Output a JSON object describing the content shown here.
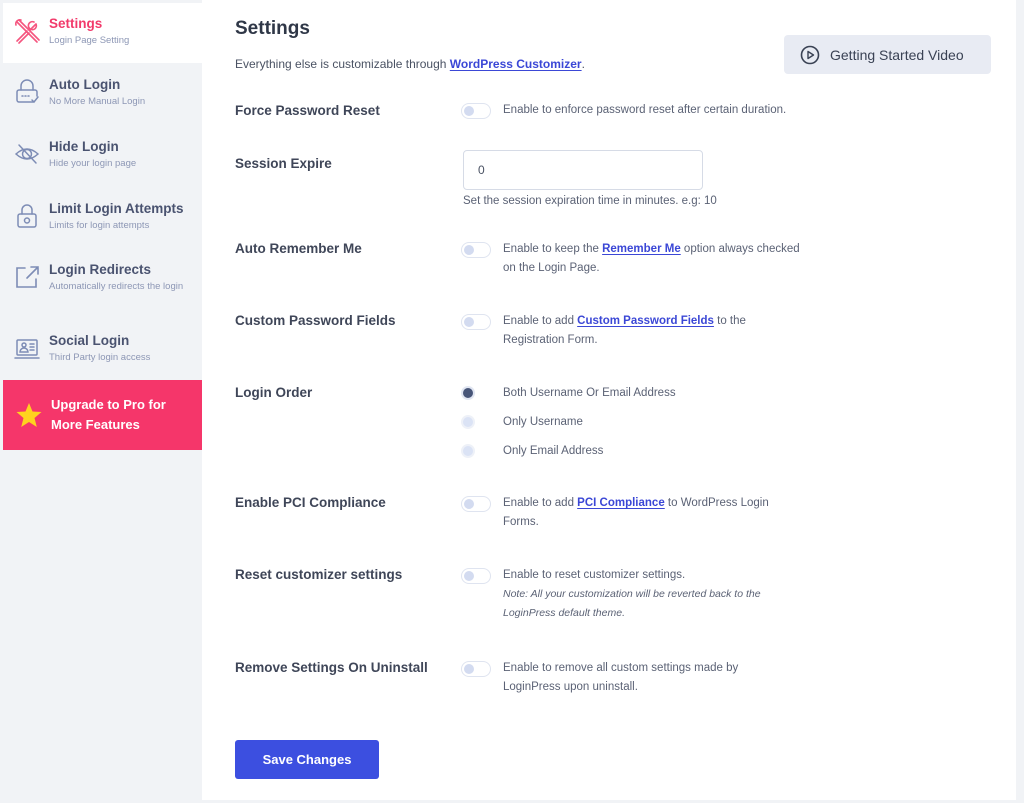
{
  "sidebar": {
    "items": [
      {
        "title": "Settings",
        "subtitle": "Login Page Setting",
        "icon": "tools-icon",
        "active": true
      },
      {
        "title": "Auto Login",
        "subtitle": "No More Manual Login",
        "icon": "lock-check-icon"
      },
      {
        "title": "Hide Login",
        "subtitle": "Hide your login page",
        "icon": "eye-slash-icon"
      },
      {
        "title": "Limit Login Attempts",
        "subtitle": "Limits for login attempts",
        "icon": "padlock-icon"
      },
      {
        "title": "Login Redirects",
        "subtitle": "Automatically redirects the login",
        "icon": "external-link-icon"
      },
      {
        "title": "Social Login",
        "subtitle": "Third Party login access",
        "icon": "id-card-icon"
      }
    ],
    "upgrade": {
      "label": "Upgrade to Pro for More Features",
      "icon": "star-icon"
    }
  },
  "header": {
    "title": "Settings",
    "intro_prefix": "Everything else is customizable through ",
    "intro_link": "WordPress Customizer",
    "intro_suffix": ".",
    "video_button": "Getting Started Video"
  },
  "settings": {
    "force_password_reset": {
      "label": "Force Password Reset",
      "enabled": false,
      "description": "Enable to enforce password reset after certain duration."
    },
    "session_expire": {
      "label": "Session Expire",
      "value": "0",
      "help": "Set the session expiration time in minutes. e.g: 10"
    },
    "auto_remember_me": {
      "label": "Auto Remember Me",
      "enabled": false,
      "desc_prefix": "Enable to keep the ",
      "desc_link": "Remember Me",
      "desc_suffix": " option always checked on the Login Page."
    },
    "custom_password_fields": {
      "label": "Custom Password Fields",
      "enabled": false,
      "desc_prefix": "Enable to add ",
      "desc_link": "Custom Password Fields",
      "desc_suffix": " to the Registration Form."
    },
    "login_order": {
      "label": "Login Order",
      "options": [
        "Both Username Or Email Address",
        "Only Username",
        "Only Email Address"
      ],
      "selected": "Both Username Or Email Address"
    },
    "pci_compliance": {
      "label": "Enable PCI Compliance",
      "enabled": false,
      "desc_prefix": "Enable to add ",
      "desc_link": "PCI Compliance",
      "desc_suffix": " to WordPress Login Forms."
    },
    "reset_customizer": {
      "label": "Reset customizer settings",
      "enabled": false,
      "description": "Enable to reset customizer settings.",
      "note": "Note: All your customization will be reverted back to the LoginPress default theme."
    },
    "remove_on_uninstall": {
      "label": "Remove Settings On Uninstall",
      "enabled": false,
      "description": "Enable to remove all custom settings made by LoginPress upon uninstall."
    }
  },
  "save_button": "Save Changes",
  "colors": {
    "accent": "#f5366a",
    "primary": "#3c4fe0",
    "link": "#3b47d6"
  }
}
